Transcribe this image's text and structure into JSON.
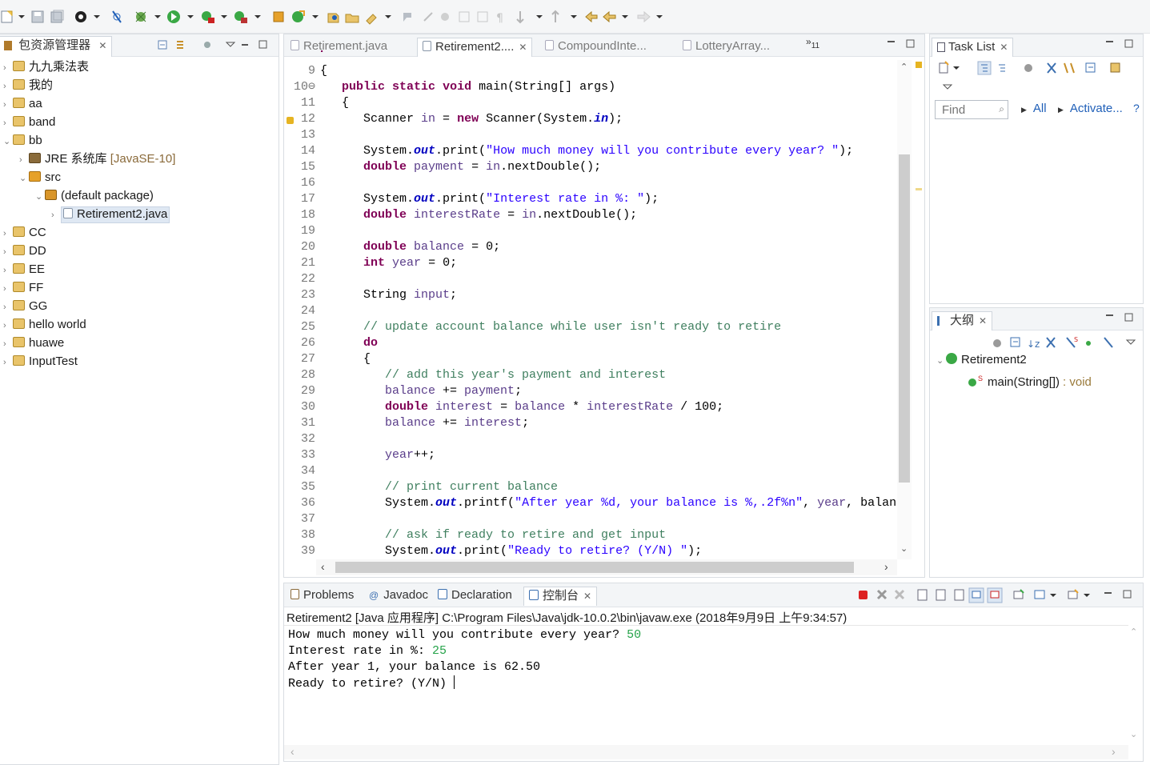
{
  "package_explorer": {
    "tab_label": "包资源管理器",
    "projects": [
      {
        "name": "九九乘法表"
      },
      {
        "name": "我的"
      },
      {
        "name": "aa"
      },
      {
        "name": "band"
      },
      {
        "name": "bb"
      }
    ],
    "jre_label": "JRE 系统库",
    "jre_version": "[JavaSE-10]",
    "src_label": "src",
    "default_package": "(default package)",
    "selected_file": "Retirement2.java",
    "more_projects": [
      {
        "name": "CC"
      },
      {
        "name": "DD"
      },
      {
        "name": "EE"
      },
      {
        "name": "FF"
      },
      {
        "name": "GG"
      },
      {
        "name": "hello world"
      },
      {
        "name": "huawe"
      },
      {
        "name": "InputTest"
      }
    ]
  },
  "editor": {
    "tabs": [
      {
        "label": "Retirement.java"
      },
      {
        "label": "Retirement2...."
      },
      {
        "label": "CompoundInte..."
      },
      {
        "label": "LotteryArray..."
      }
    ],
    "overflow_count": "11",
    "lines": [
      {
        "n": "9",
        "code": "{"
      },
      {
        "n": "10",
        "code": "   public static void main(String[] args)"
      },
      {
        "n": "11",
        "code": "   {"
      },
      {
        "n": "12",
        "code": "      Scanner in = new Scanner(System.in);"
      },
      {
        "n": "13",
        "code": ""
      },
      {
        "n": "14",
        "code": "      System.out.print(\"How much money will you contribute every year? \");"
      },
      {
        "n": "15",
        "code": "      double payment = in.nextDouble();"
      },
      {
        "n": "16",
        "code": ""
      },
      {
        "n": "17",
        "code": "      System.out.print(\"Interest rate in %: \");"
      },
      {
        "n": "18",
        "code": "      double interestRate = in.nextDouble();"
      },
      {
        "n": "19",
        "code": ""
      },
      {
        "n": "20",
        "code": "      double balance = 0;"
      },
      {
        "n": "21",
        "code": "      int year = 0;"
      },
      {
        "n": "22",
        "code": ""
      },
      {
        "n": "23",
        "code": "      String input;"
      },
      {
        "n": "24",
        "code": ""
      },
      {
        "n": "25",
        "code": "      // update account balance while user isn't ready to retire"
      },
      {
        "n": "26",
        "code": "      do"
      },
      {
        "n": "27",
        "code": "      {"
      },
      {
        "n": "28",
        "code": "         // add this year's payment and interest"
      },
      {
        "n": "29",
        "code": "         balance += payment;"
      },
      {
        "n": "30",
        "code": "         double interest = balance * interestRate / 100;"
      },
      {
        "n": "31",
        "code": "         balance += interest;"
      },
      {
        "n": "32",
        "code": ""
      },
      {
        "n": "33",
        "code": "         year++;"
      },
      {
        "n": "34",
        "code": ""
      },
      {
        "n": "35",
        "code": "         // print current balance"
      },
      {
        "n": "36",
        "code": "         System.out.printf(\"After year %d, your balance is %,.2f%n\", year, balan"
      },
      {
        "n": "37",
        "code": ""
      },
      {
        "n": "38",
        "code": "         // ask if ready to retire and get input"
      },
      {
        "n": "39",
        "code": "         System.out.print(\"Ready to retire? (Y/N) \");"
      }
    ]
  },
  "task_list": {
    "tab_label": "Task List",
    "find_placeholder": "Find",
    "all_label": "All",
    "activate_label": "Activate..."
  },
  "outline": {
    "tab_label": "大纲",
    "class_name": "Retirement2",
    "method_name": "main(String[])",
    "method_type": ": void",
    "static_marker": "S"
  },
  "bottom": {
    "tabs": [
      {
        "label": "Problems"
      },
      {
        "label": "Javadoc"
      },
      {
        "label": "Declaration"
      },
      {
        "label": "控制台"
      }
    ],
    "console_header": "Retirement2 [Java 应用程序] C:\\Program Files\\Java\\jdk-10.0.2\\bin\\javaw.exe  (2018年9月9日 上午9:34:57)",
    "console_lines": [
      {
        "text": "How much money will you contribute every year? ",
        "input": "50"
      },
      {
        "text": "Interest rate in %: ",
        "input": "25"
      },
      {
        "text": "After year 1, your balance is 62.50",
        "input": ""
      },
      {
        "text": "Ready to retire? (Y/N) ",
        "input": ""
      }
    ]
  },
  "colors": {
    "keyword": "#7f0055",
    "string": "#2a00ff",
    "comment": "#3f7f5f",
    "field": "#0000c0",
    "console_input": "#26a34a",
    "link": "#1f5fb8"
  }
}
